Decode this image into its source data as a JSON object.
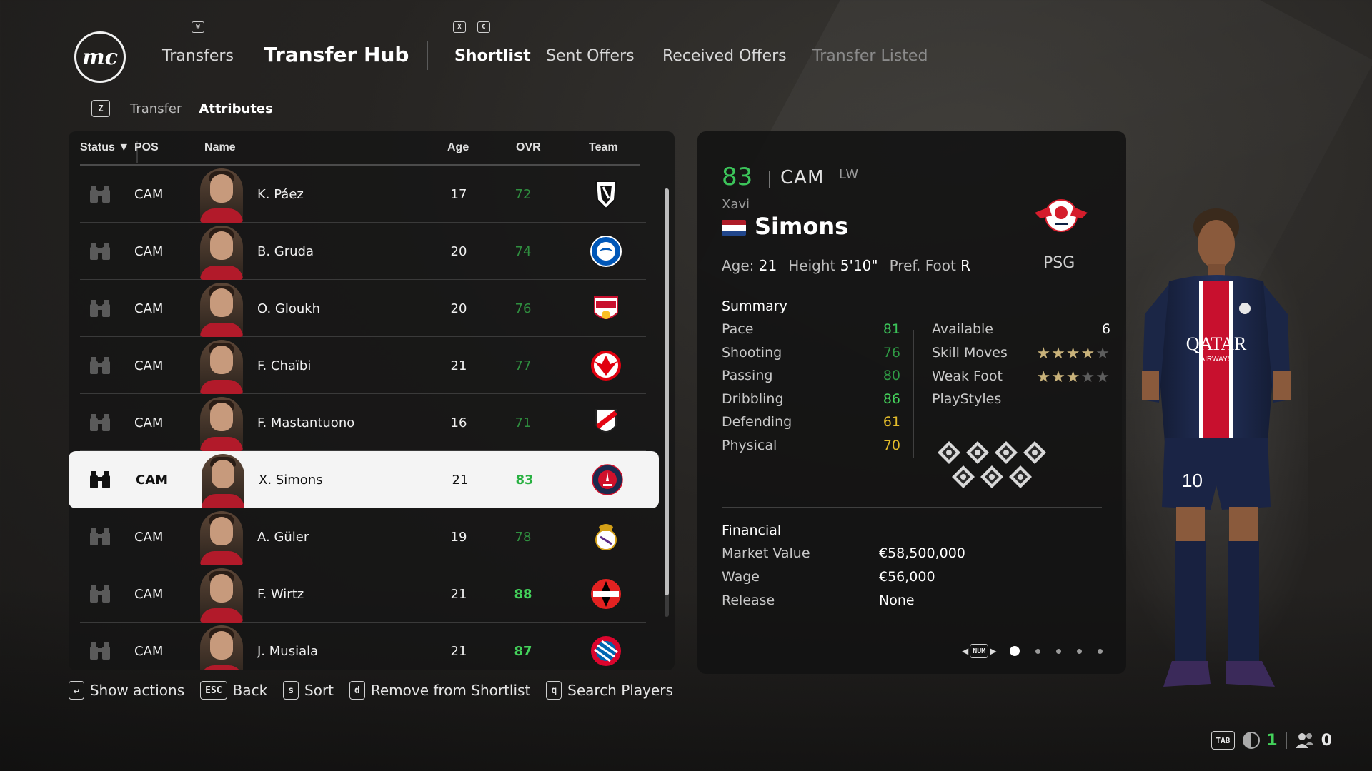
{
  "header": {
    "logo": "mc",
    "transfers_key": "W",
    "transfers_label": "Transfers",
    "title": "Transfer Hub",
    "shortlist_keys": [
      "X",
      "C"
    ],
    "tabs": [
      {
        "label": "Shortlist"
      },
      {
        "label": "Sent Offers"
      },
      {
        "label": "Received Offers"
      },
      {
        "label": "Transfer Listed"
      }
    ]
  },
  "subnav": {
    "key": "Z",
    "items": [
      {
        "label": "Transfer"
      },
      {
        "label": "Attributes"
      }
    ]
  },
  "list": {
    "columns": {
      "status": "Status",
      "pos": "POS",
      "name": "Name",
      "age": "Age",
      "ovr": "OVR",
      "team": "Team"
    },
    "rows": [
      {
        "pos": "CAM",
        "name": "K. Páez",
        "age": "17",
        "ovr": "72",
        "team_icon": "independiente-del-valle-crest-icon"
      },
      {
        "pos": "CAM",
        "name": "B. Gruda",
        "age": "20",
        "ovr": "74",
        "team_icon": "brighton-crest-icon"
      },
      {
        "pos": "CAM",
        "name": "O. Gloukh",
        "age": "20",
        "ovr": "76",
        "team_icon": "rb-salzburg-crest-icon"
      },
      {
        "pos": "CAM",
        "name": "F. Chaïbi",
        "age": "21",
        "ovr": "77",
        "team_icon": "eintracht-frankfurt-crest-icon"
      },
      {
        "pos": "CAM",
        "name": "F. Mastantuono",
        "age": "16",
        "ovr": "71",
        "team_icon": "river-plate-crest-icon"
      },
      {
        "pos": "CAM",
        "name": "X. Simons",
        "age": "21",
        "ovr": "83",
        "team_icon": "psg-crest-icon",
        "selected": true
      },
      {
        "pos": "CAM",
        "name": "A. Güler",
        "age": "19",
        "ovr": "78",
        "team_icon": "real-madrid-crest-icon"
      },
      {
        "pos": "CAM",
        "name": "F. Wirtz",
        "age": "21",
        "ovr": "88",
        "team_icon": "leverkusen-crest-icon"
      },
      {
        "pos": "CAM",
        "name": "J. Musiala",
        "age": "21",
        "ovr": "87",
        "team_icon": "bayern-crest-icon"
      }
    ]
  },
  "footer": {
    "actions": [
      {
        "key": "↵",
        "label": "Show actions"
      },
      {
        "key": "ESC",
        "label": "Back"
      },
      {
        "key": "s",
        "label": "Sort"
      },
      {
        "key": "d",
        "label": "Remove from Shortlist"
      },
      {
        "key": "q",
        "label": "Search Players"
      }
    ]
  },
  "player": {
    "ovr": "83",
    "position": "CAM",
    "alt_position": "LW",
    "first_name": "Xavi",
    "last_name": "Simons",
    "nation_flag": "netherlands-flag-icon",
    "club_crest": "rb-leipzig-crest-icon",
    "age_label": "Age:",
    "age": "21",
    "height_label": "Height",
    "height": "5'10\"",
    "foot_label": "Pref. Foot",
    "foot": "R",
    "team": "PSG",
    "summary_title": "Summary",
    "attributes": [
      {
        "label": "Pace",
        "value": "81",
        "color": "#3cc45a"
      },
      {
        "label": "Shooting",
        "value": "76",
        "color": "#2f9a44"
      },
      {
        "label": "Passing",
        "value": "80",
        "color": "#2f9a44"
      },
      {
        "label": "Dribbling",
        "value": "86",
        "color": "#45d45c"
      },
      {
        "label": "Defending",
        "value": "61",
        "color": "#e2bb2a"
      },
      {
        "label": "Physical",
        "value": "70",
        "color": "#e2bb2a"
      }
    ],
    "available_label": "Available",
    "available": "6",
    "skill_moves_label": "Skill Moves",
    "skill_moves_stars": 4,
    "weak_foot_label": "Weak Foot",
    "weak_foot_stars": 3,
    "playstyles_label": "PlayStyles",
    "playstyle_count": 7,
    "financial_title": "Financial",
    "market_value_label": "Market Value",
    "market_value": "€58,500,000",
    "wage_label": "Wage",
    "wage": "€56,000",
    "release_label": "Release",
    "release": "None",
    "pager_key": "NUM",
    "pager_pages": 5,
    "pager_current": 1
  },
  "status_bar": {
    "tab_key": "TAB",
    "scouts_count": "1",
    "users_count": "0"
  },
  "colors": {
    "ovr_green": "#3cc45a",
    "ovr_green_bright": "#43d15a",
    "star_gold": "#c9b27a",
    "psg_navy": "#1c2a4d",
    "psg_red": "#d0112b"
  }
}
